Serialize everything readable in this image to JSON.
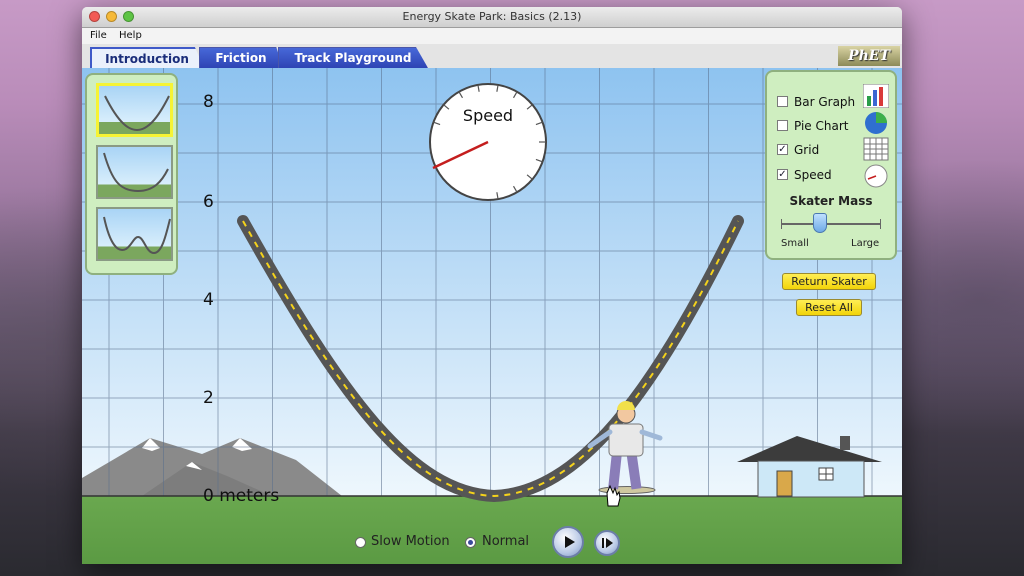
{
  "window": {
    "title": "Energy Skate Park: Basics (2.13)"
  },
  "menu": [
    "File",
    "Help"
  ],
  "tabs": [
    {
      "label": "Introduction",
      "active": true
    },
    {
      "label": "Friction",
      "active": false
    },
    {
      "label": "Track Playground",
      "active": false
    }
  ],
  "logo_text": "PhET",
  "grid_labels": {
    "y8": "8",
    "y6": "6",
    "y4": "4",
    "y2": "2",
    "zero": "0 meters"
  },
  "speedometer": {
    "label": "Speed"
  },
  "track_thumbnails": {
    "selected_index": 0
  },
  "options": [
    {
      "label": "Bar Graph",
      "checked": false,
      "icon": "bar-graph-icon"
    },
    {
      "label": "Pie Chart",
      "checked": false,
      "icon": "pie-chart-icon"
    },
    {
      "label": "Grid",
      "checked": true,
      "icon": "grid-icon"
    },
    {
      "label": "Speed",
      "checked": true,
      "icon": "speedometer-icon"
    }
  ],
  "skater_mass": {
    "title": "Skater Mass",
    "min_label": "Small",
    "max_label": "Large"
  },
  "buttons": {
    "return_skater": "Return Skater",
    "reset_all": "Reset All"
  },
  "playback": {
    "slow_motion": "Slow Motion",
    "normal": "Normal",
    "selected": "Normal"
  },
  "colors": {
    "sky_top": "#8ec3f0",
    "grass": "#6aa84f",
    "track": "#5a5a5a",
    "track_stripe": "#f4d21b",
    "panel": "#cfeec0",
    "tab_active": "#eaf0fb",
    "tab_inactive": "#3b56c8"
  }
}
